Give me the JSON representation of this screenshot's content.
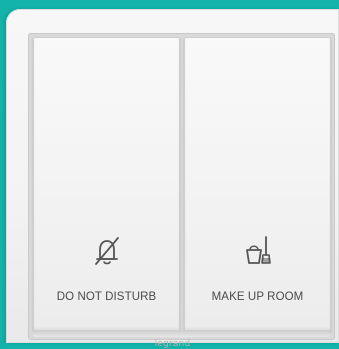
{
  "switches": [
    {
      "label": "DO NOT DISTURB",
      "icon": "bell-slash-icon"
    },
    {
      "label": "MAKE UP ROOM",
      "icon": "bucket-broom-icon"
    }
  ],
  "brand": "legrand",
  "colors": {
    "background": "#14b3aa",
    "plate": "#f3f3f3",
    "label_text": "#4a4a4a"
  }
}
